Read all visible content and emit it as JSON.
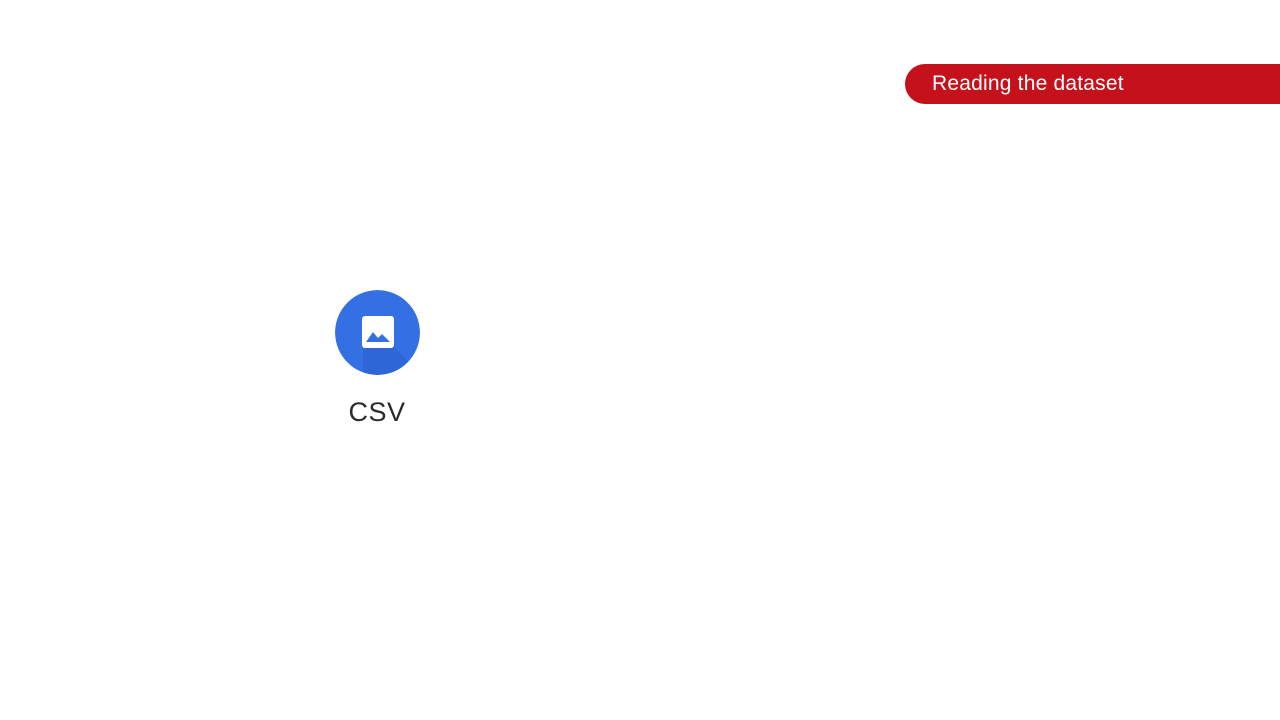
{
  "banner": {
    "text": "Reading the dataset",
    "color": "#c5111c"
  },
  "csv_node": {
    "label": "CSV",
    "icon": "image-icon",
    "color": "#3470e4"
  }
}
